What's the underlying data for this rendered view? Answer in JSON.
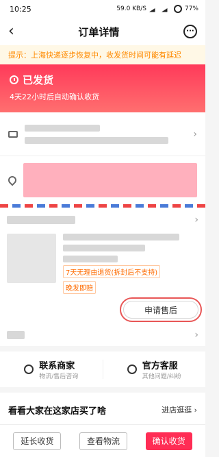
{
  "status_bar": {
    "time": "10:25",
    "net": "59.0 KB/S",
    "battery": "77%"
  },
  "nav": {
    "title": "订单详情",
    "back_icon": "back-arrow-icon",
    "more_icon": "more-dots-icon"
  },
  "notice": {
    "text": "提示：上海快递逐步恢复中，收发货时间可能有延迟"
  },
  "shipping": {
    "status": "已发货",
    "subtitle": "4天22小时后自动确认收货"
  },
  "goods": {
    "tags": [
      "7天无理由退货(拆封后不支持)",
      "晚发即赔"
    ],
    "after_sale_button": "申请售后"
  },
  "contacts": [
    {
      "title": "联系商家",
      "subtitle": "物流/售后咨询"
    },
    {
      "title": "官方客服",
      "subtitle": "其他问题/纠纷"
    }
  ],
  "recommend": {
    "title": "看看大家在这家店买了啥",
    "link": "进店逛逛"
  },
  "bottom_actions": {
    "extend": "延长收货",
    "logistics": "查看物流",
    "confirm": "确认收货"
  }
}
